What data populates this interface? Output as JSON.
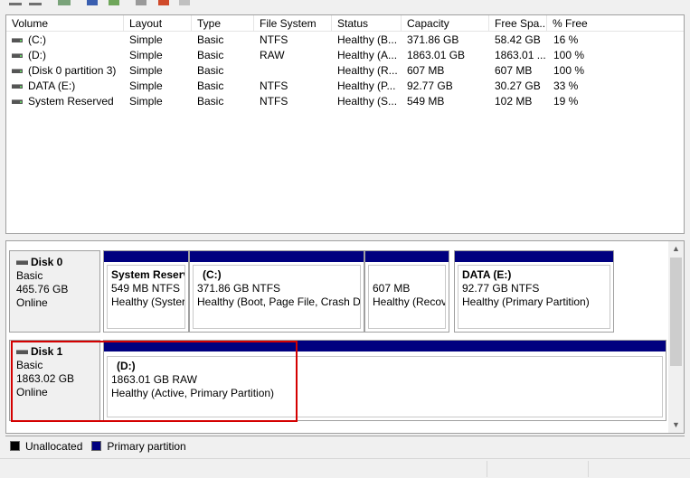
{
  "toolbar": {
    "buttons": [
      "back-icon",
      "forward-icon",
      "up-icon",
      "help-icon",
      "properties-icon",
      "search-icon",
      "refresh-icon",
      "list-icon"
    ]
  },
  "volume_list": {
    "columns": [
      "Volume",
      "Layout",
      "Type",
      "File System",
      "Status",
      "Capacity",
      "Free Spa...",
      "% Free"
    ],
    "rows": [
      {
        "volume": "(C:)",
        "layout": "Simple",
        "type": "Basic",
        "fs": "NTFS",
        "status": "Healthy (B...",
        "capacity": "371.86 GB",
        "free": "58.42 GB",
        "pct": "16 %"
      },
      {
        "volume": "(D:)",
        "layout": "Simple",
        "type": "Basic",
        "fs": "RAW",
        "status": "Healthy (A...",
        "capacity": "1863.01 GB",
        "free": "1863.01 ...",
        "pct": "100 %"
      },
      {
        "volume": "(Disk 0 partition 3)",
        "layout": "Simple",
        "type": "Basic",
        "fs": "",
        "status": "Healthy (R...",
        "capacity": "607 MB",
        "free": "607 MB",
        "pct": "100 %"
      },
      {
        "volume": "DATA (E:)",
        "layout": "Simple",
        "type": "Basic",
        "fs": "NTFS",
        "status": "Healthy (P...",
        "capacity": "92.77 GB",
        "free": "30.27 GB",
        "pct": "33 %"
      },
      {
        "volume": "System Reserved",
        "layout": "Simple",
        "type": "Basic",
        "fs": "NTFS",
        "status": "Healthy (S...",
        "capacity": "549 MB",
        "free": "102 MB",
        "pct": "19 %"
      }
    ]
  },
  "disks": [
    {
      "name": "Disk 0",
      "type": "Basic",
      "size": "465.76 GB",
      "state": "Online",
      "partitions": [
        {
          "name": "System Reserv",
          "size": "549 MB NTFS",
          "status": "Healthy (Syster"
        },
        {
          "name": "(C:)",
          "size": "371.86 GB NTFS",
          "status": "Healthy (Boot, Page File, Crash Du"
        },
        {
          "name": "",
          "size": "607 MB",
          "status": "Healthy (Recov"
        },
        {
          "name": "DATA  (E:)",
          "size": "92.77 GB NTFS",
          "status": "Healthy (Primary Partition)"
        }
      ]
    },
    {
      "name": "Disk 1",
      "type": "Basic",
      "size": "1863.02 GB",
      "state": "Online",
      "partitions": [
        {
          "name": "(D:)",
          "size": "1863.01 GB RAW",
          "status": "Healthy (Active, Primary Partition)"
        }
      ]
    }
  ],
  "legend": {
    "items": [
      {
        "label": "Unallocated",
        "color": "#000000"
      },
      {
        "label": "Primary partition",
        "color": "#00007f"
      }
    ]
  },
  "colors": {
    "partition_bar": "#00007f",
    "highlight": "#d40000"
  }
}
